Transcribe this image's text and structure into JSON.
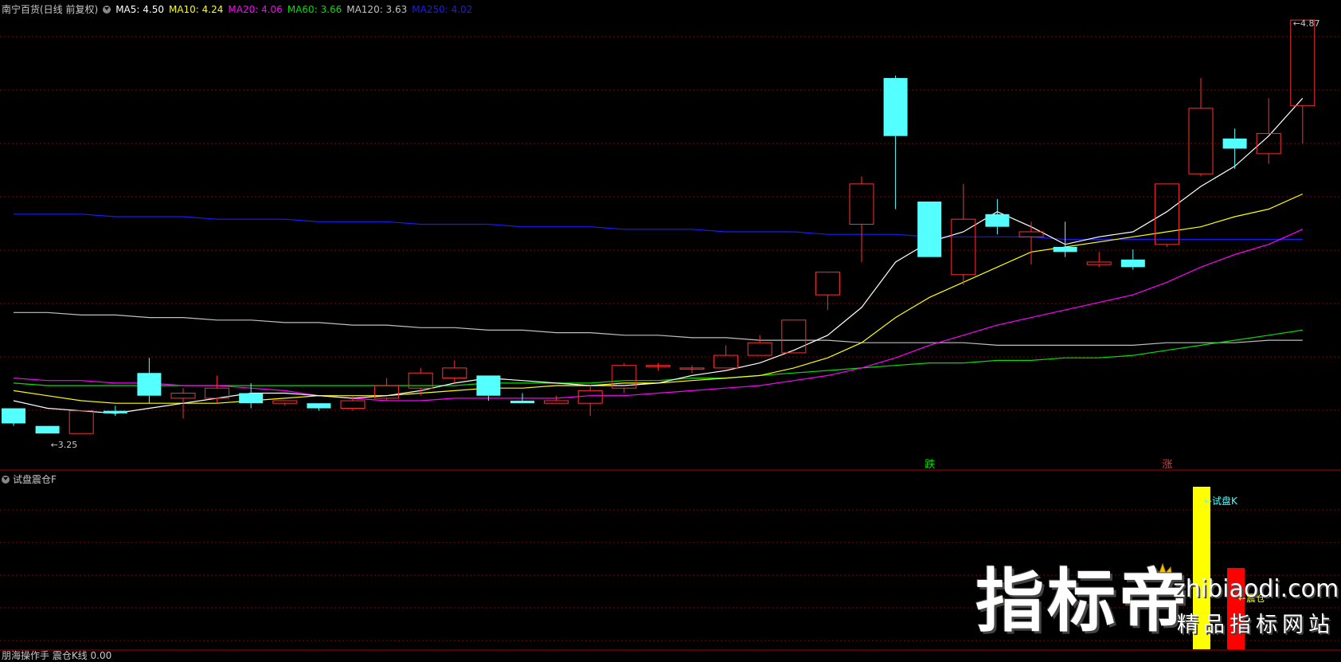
{
  "legend": {
    "title": "南宁百货(日线 前复权)",
    "ma5": "MA5: 4.50",
    "ma10": "MA10: 4.24",
    "ma20": "MA20: 4.06",
    "ma60": "MA60: 3.66",
    "ma120": "MA120: 3.63",
    "ma250": "MA250: 4.02"
  },
  "colors": {
    "up": "#ff3030",
    "down": "#54ffff",
    "ma5": "#ffffff",
    "ma10": "#ffff00",
    "ma20": "#ff00ff",
    "ma60": "#00e000",
    "ma120": "#c0c0c0",
    "ma250": "#1a1aff",
    "grid": "#8b0000"
  },
  "annotations": {
    "low_label": "3.25",
    "high_label": "4.87",
    "signal_down": "跌",
    "signal_up": "涨"
  },
  "sub_panel": {
    "title": "试盘震仓F",
    "bar1_label": "试盘K",
    "bar1_value": 1.0,
    "bar2_label": "震仓",
    "bar2_value": 0.5
  },
  "bottom_panel": {
    "title": "朋海操作手 震仓K线 0.00"
  },
  "watermark": {
    "main": "指标帝",
    "site": "zhibiaodi.com",
    "slogan": "精品指标网站"
  },
  "chart_data": {
    "type": "candlestick",
    "ylim": [
      3.2,
      4.9
    ],
    "candles": [
      {
        "o": 3.35,
        "c": 3.29,
        "h": 3.35,
        "l": 3.28
      },
      {
        "o": 3.28,
        "c": 3.25,
        "h": 3.28,
        "l": 3.25
      },
      {
        "o": 3.25,
        "c": 3.34,
        "h": 3.34,
        "l": 3.25
      },
      {
        "o": 3.34,
        "c": 3.33,
        "h": 3.36,
        "l": 3.32
      },
      {
        "o": 3.49,
        "c": 3.4,
        "h": 3.55,
        "l": 3.37
      },
      {
        "o": 3.39,
        "c": 3.41,
        "h": 3.43,
        "l": 3.31
      },
      {
        "o": 3.39,
        "c": 3.43,
        "h": 3.48,
        "l": 3.37
      },
      {
        "o": 3.41,
        "c": 3.37,
        "h": 3.45,
        "l": 3.35
      },
      {
        "o": 3.37,
        "c": 3.38,
        "h": 3.38,
        "l": 3.36
      },
      {
        "o": 3.37,
        "c": 3.35,
        "h": 3.37,
        "l": 3.34
      },
      {
        "o": 3.35,
        "c": 3.38,
        "h": 3.4,
        "l": 3.34
      },
      {
        "o": 3.39,
        "c": 3.44,
        "h": 3.47,
        "l": 3.38
      },
      {
        "o": 3.43,
        "c": 3.49,
        "h": 3.51,
        "l": 3.4
      },
      {
        "o": 3.47,
        "c": 3.51,
        "h": 3.54,
        "l": 3.45
      },
      {
        "o": 3.48,
        "c": 3.4,
        "h": 3.48,
        "l": 3.38
      },
      {
        "o": 3.38,
        "c": 3.37,
        "h": 3.41,
        "l": 3.37
      },
      {
        "o": 3.37,
        "c": 3.38,
        "h": 3.4,
        "l": 3.37
      },
      {
        "o": 3.37,
        "c": 3.42,
        "h": 3.44,
        "l": 3.32
      },
      {
        "o": 3.43,
        "c": 3.52,
        "h": 3.53,
        "l": 3.41
      },
      {
        "o": 3.52,
        "c": 3.52,
        "h": 3.53,
        "l": 3.5
      },
      {
        "o": 3.51,
        "c": 3.51,
        "h": 3.52,
        "l": 3.49
      },
      {
        "o": 3.51,
        "c": 3.56,
        "h": 3.6,
        "l": 3.51
      },
      {
        "o": 3.56,
        "c": 3.61,
        "h": 3.64,
        "l": 3.56
      },
      {
        "o": 3.57,
        "c": 3.7,
        "h": 3.7,
        "l": 3.57
      },
      {
        "o": 3.8,
        "c": 3.89,
        "h": 3.89,
        "l": 3.74
      },
      {
        "o": 4.08,
        "c": 4.24,
        "h": 4.27,
        "l": 3.93
      },
      {
        "o": 4.66,
        "c": 4.43,
        "h": 4.67,
        "l": 4.14
      },
      {
        "o": 4.17,
        "c": 3.95,
        "h": 4.17,
        "l": 3.95
      },
      {
        "o": 3.88,
        "c": 4.1,
        "h": 4.24,
        "l": 3.84
      },
      {
        "o": 4.12,
        "c": 4.07,
        "h": 4.18,
        "l": 4.04
      },
      {
        "o": 4.03,
        "c": 4.05,
        "h": 4.09,
        "l": 3.92
      },
      {
        "o": 3.99,
        "c": 3.97,
        "h": 4.09,
        "l": 3.95
      },
      {
        "o": 3.92,
        "c": 3.93,
        "h": 3.97,
        "l": 3.91
      },
      {
        "o": 3.94,
        "c": 3.91,
        "h": 3.98,
        "l": 3.9
      },
      {
        "o": 4.0,
        "c": 4.24,
        "h": 4.24,
        "l": 3.99
      },
      {
        "o": 4.28,
        "c": 4.54,
        "h": 4.66,
        "l": 4.27
      },
      {
        "o": 4.42,
        "c": 4.38,
        "h": 4.46,
        "l": 4.3
      },
      {
        "o": 4.36,
        "c": 4.44,
        "h": 4.58,
        "l": 4.32
      },
      {
        "o": 4.55,
        "c": 4.89,
        "h": 4.89,
        "l": 4.4
      }
    ],
    "ma5": [
      3.38,
      3.35,
      3.34,
      3.33,
      3.35,
      3.37,
      3.39,
      3.41,
      3.41,
      3.4,
      3.39,
      3.4,
      3.42,
      3.45,
      3.47,
      3.46,
      3.45,
      3.44,
      3.44,
      3.45,
      3.48,
      3.5,
      3.53,
      3.58,
      3.64,
      3.75,
      3.93,
      4.01,
      4.05,
      4.13,
      4.07,
      4.0,
      4.03,
      4.05,
      4.13,
      4.23,
      4.31,
      4.43,
      4.58
    ],
    "ma10": [
      3.42,
      3.4,
      3.38,
      3.37,
      3.37,
      3.37,
      3.37,
      3.38,
      3.39,
      3.4,
      3.4,
      3.4,
      3.41,
      3.42,
      3.43,
      3.43,
      3.44,
      3.44,
      3.45,
      3.45,
      3.46,
      3.47,
      3.48,
      3.51,
      3.55,
      3.61,
      3.71,
      3.79,
      3.85,
      3.91,
      3.97,
      3.99,
      4.01,
      4.03,
      4.05,
      4.07,
      4.11,
      4.14,
      4.2
    ],
    "ma20": [
      3.47,
      3.46,
      3.46,
      3.45,
      3.45,
      3.44,
      3.44,
      3.43,
      3.42,
      3.4,
      3.39,
      3.38,
      3.38,
      3.39,
      3.39,
      3.39,
      3.39,
      3.4,
      3.4,
      3.41,
      3.42,
      3.43,
      3.44,
      3.46,
      3.48,
      3.51,
      3.55,
      3.6,
      3.64,
      3.68,
      3.71,
      3.74,
      3.77,
      3.8,
      3.85,
      3.91,
      3.96,
      4.0,
      4.06
    ],
    "ma60": [
      3.45,
      3.44,
      3.44,
      3.44,
      3.44,
      3.44,
      3.44,
      3.44,
      3.44,
      3.44,
      3.44,
      3.44,
      3.44,
      3.44,
      3.45,
      3.45,
      3.45,
      3.45,
      3.46,
      3.46,
      3.47,
      3.47,
      3.48,
      3.49,
      3.5,
      3.51,
      3.52,
      3.53,
      3.53,
      3.54,
      3.54,
      3.55,
      3.55,
      3.56,
      3.58,
      3.6,
      3.62,
      3.64,
      3.66
    ],
    "ma120": [
      3.73,
      3.73,
      3.72,
      3.72,
      3.71,
      3.71,
      3.7,
      3.7,
      3.69,
      3.69,
      3.68,
      3.68,
      3.67,
      3.67,
      3.66,
      3.66,
      3.65,
      3.65,
      3.64,
      3.64,
      3.63,
      3.63,
      3.62,
      3.62,
      3.62,
      3.61,
      3.61,
      3.61,
      3.61,
      3.6,
      3.6,
      3.6,
      3.6,
      3.6,
      3.61,
      3.61,
      3.61,
      3.62,
      3.62
    ],
    "ma250": [
      4.12,
      4.12,
      4.12,
      4.11,
      4.11,
      4.11,
      4.1,
      4.1,
      4.1,
      4.09,
      4.09,
      4.09,
      4.08,
      4.08,
      4.08,
      4.07,
      4.07,
      4.07,
      4.06,
      4.06,
      4.06,
      4.05,
      4.05,
      4.05,
      4.04,
      4.04,
      4.04,
      4.03,
      4.03,
      4.03,
      4.03,
      4.02,
      4.02,
      4.02,
      4.02,
      4.02,
      4.02,
      4.02,
      4.02
    ],
    "low_index": 1,
    "high_index": 38,
    "signal_down_index": 27,
    "signal_up_index": 34
  }
}
